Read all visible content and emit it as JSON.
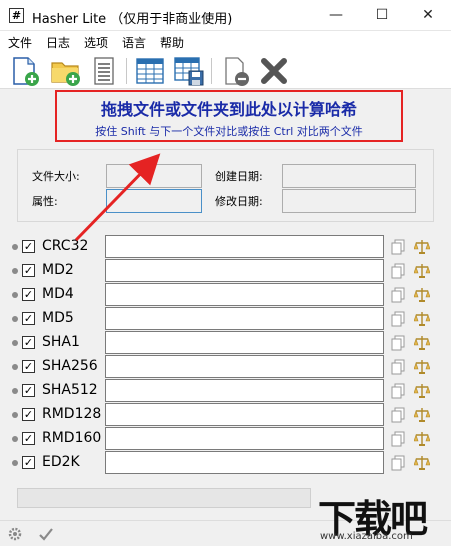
{
  "window": {
    "icon_glyph": "#",
    "title": "Hasher Lite （仅用于非商业使用)",
    "minimize": "—",
    "maximize": "☐",
    "close": "✕"
  },
  "menu": {
    "items": [
      "文件",
      "日志",
      "选项",
      "语言",
      "帮助"
    ]
  },
  "toolbar": {
    "buttons": [
      "add-file-icon",
      "add-folder-icon",
      "document-icon",
      "table-icon",
      "save-table-icon",
      "remove-icon",
      "clear-icon"
    ]
  },
  "dropzone": {
    "title": "拖拽文件或文件夹到此处以计算哈希",
    "subtitle": "按住 Shift 与下一个文件对比或按住 Ctrl 对比两个文件",
    "border_color": "#e52323",
    "text_color": "#1a2ba8"
  },
  "info": {
    "file_size_label": "文件大小:",
    "attributes_label": "属性:",
    "created_label": "创建日期:",
    "modified_label": "修改日期:",
    "file_size_value": "",
    "attributes_value": "",
    "created_value": "",
    "modified_value": ""
  },
  "hashes": [
    {
      "name": "CRC32",
      "checked": true,
      "value": ""
    },
    {
      "name": "MD2",
      "checked": true,
      "value": ""
    },
    {
      "name": "MD4",
      "checked": true,
      "value": ""
    },
    {
      "name": "MD5",
      "checked": true,
      "value": ""
    },
    {
      "name": "SHA1",
      "checked": true,
      "value": ""
    },
    {
      "name": "SHA256",
      "checked": true,
      "value": ""
    },
    {
      "name": "SHA512",
      "checked": true,
      "value": ""
    },
    {
      "name": "RMD128",
      "checked": true,
      "value": ""
    },
    {
      "name": "RMD160",
      "checked": true,
      "value": ""
    },
    {
      "name": "ED2K",
      "checked": true,
      "value": ""
    }
  ],
  "progress": {
    "fraction": 0
  },
  "watermark": {
    "big": "下载吧",
    "small": "www.xiazaiba.com"
  },
  "checkmark": "✓"
}
